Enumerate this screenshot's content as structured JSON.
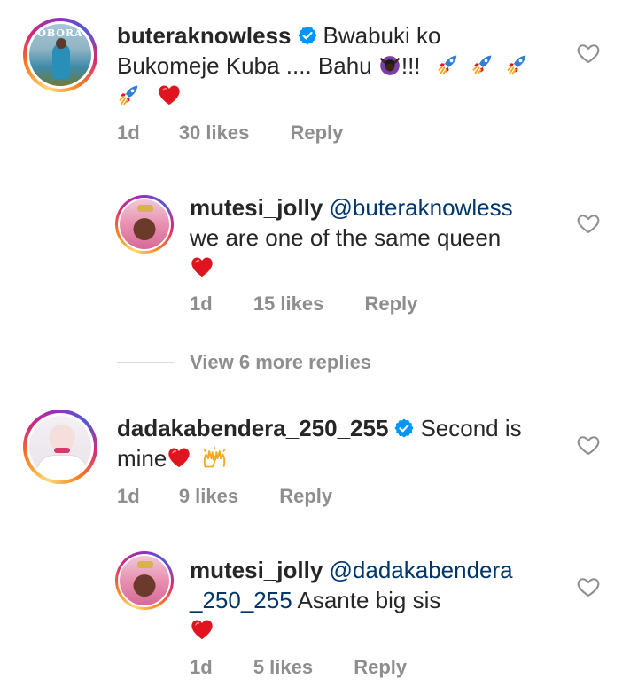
{
  "comments": [
    {
      "username": "buteraknowless",
      "verified": true,
      "text_line1": "Bwabuki ko",
      "text_line2": "Bukomeje Kuba .... Bahu",
      "text_after_emoji": "!!!",
      "age": "1d",
      "likes": "30 likes",
      "reply": "Reply",
      "avatar_caption": "OBORA"
    },
    {
      "username": "mutesi_jolly",
      "mention": "@buteraknowless",
      "text_line2": "we are one of the same queen",
      "age": "1d",
      "likes": "15 likes",
      "reply": "Reply"
    },
    {
      "username": "dadakabendera_250_255",
      "verified": true,
      "text_line1": "Second is",
      "text_line2": "mine",
      "age": "1d",
      "likes": "9 likes",
      "reply": "Reply"
    },
    {
      "username": "mutesi_jolly",
      "mention_part1": "@dadakabendera",
      "mention_part2": "_250_255",
      "text_after_mention": " Asante big sis",
      "age": "1d",
      "likes": "5 likes",
      "reply": "Reply"
    }
  ],
  "view_more": "View 6 more replies",
  "icons": {
    "heart": "heart-outline-icon",
    "verified": "verified-badge-icon"
  },
  "colors": {
    "text": "#262626",
    "meta": "#8e8e8e",
    "mention": "#00376b",
    "verified": "#0095f6",
    "heart_emoji": "#e0141e"
  }
}
